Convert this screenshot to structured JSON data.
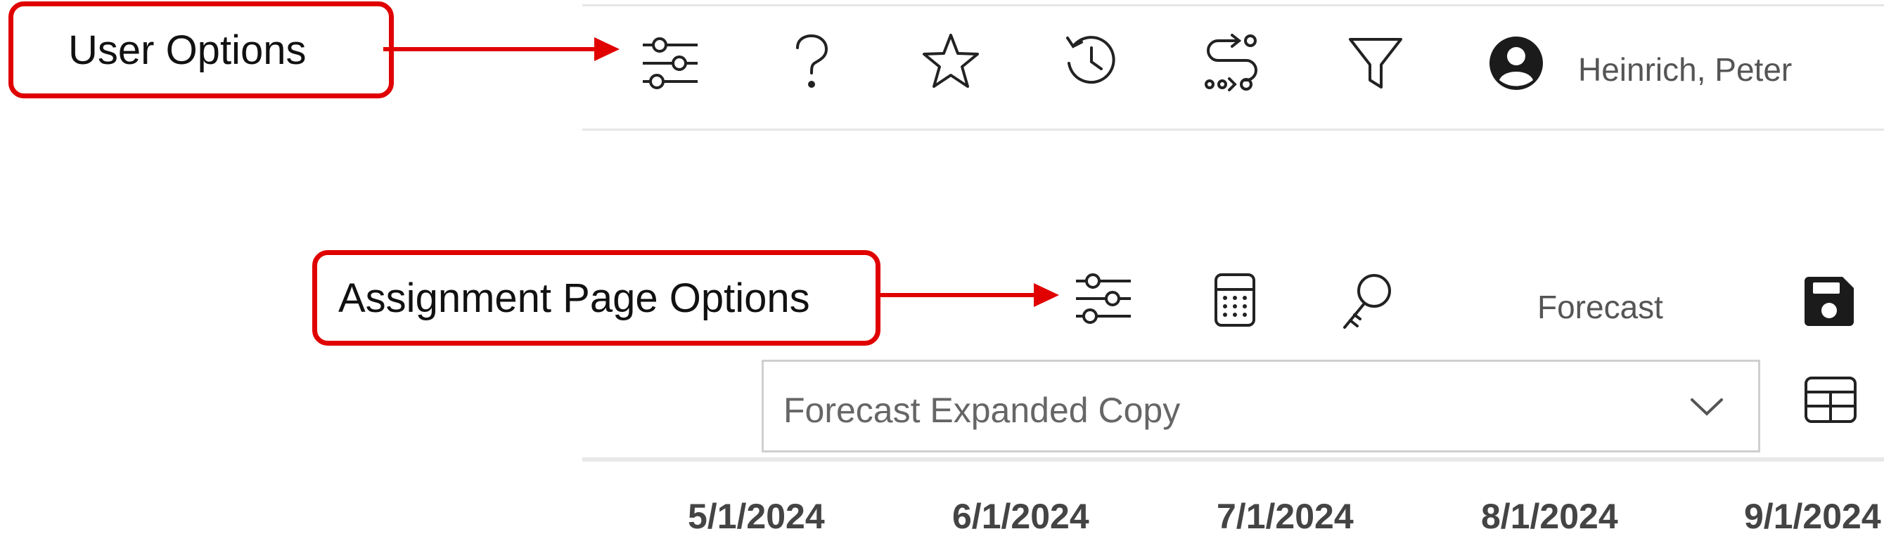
{
  "annotations": {
    "user_options": "User Options",
    "assignment_page_options": "Assignment Page Options",
    "accent_color": "#e00000"
  },
  "user_toolbar": {
    "icons": [
      "settings-sliders-icon",
      "help-icon",
      "favorites-star-icon",
      "history-icon",
      "workflow-route-icon",
      "filter-icon",
      "user-avatar-icon"
    ],
    "user_name": "Heinrich, Peter"
  },
  "assignment_toolbar": {
    "icons": [
      "page-settings-sliders-icon",
      "calculator-icon",
      "key-icon",
      "save-icon",
      "table-layout-icon"
    ],
    "view_label": "Forecast",
    "layout_select": {
      "selected": "Forecast Expanded Copy"
    }
  },
  "timeline": {
    "dates": [
      "5/1/2024",
      "6/1/2024",
      "7/1/2024",
      "8/1/2024",
      "9/1/2024"
    ]
  }
}
